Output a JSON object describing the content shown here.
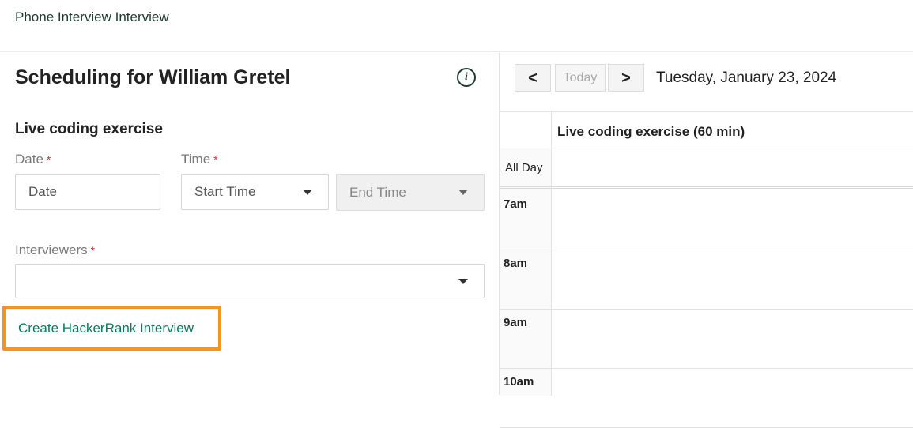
{
  "header": {
    "breadcrumb": "Phone Interview Interview"
  },
  "scheduler": {
    "title": "Scheduling for William Gretel",
    "section_title": "Live coding exercise",
    "date_label": "Date",
    "time_label": "Time",
    "required_mark": "*",
    "date_placeholder": "Date",
    "start_time_placeholder": "Start Time",
    "end_time_placeholder": "End Time",
    "interviewers_label": "Interviewers",
    "create_link": "Create HackerRank Interview"
  },
  "calendar": {
    "prev_label": "<",
    "today_label": "Today",
    "next_label": ">",
    "date": "Tuesday, January 23, 2024",
    "column_title": "Live coding exercise (60 min)",
    "all_day_label": "All Day",
    "hours": [
      "7am",
      "8am",
      "9am",
      "10am"
    ]
  },
  "colors": {
    "accent_link": "#0a7a5c",
    "highlight_border": "#f7941d",
    "required": "#d32f2f"
  }
}
